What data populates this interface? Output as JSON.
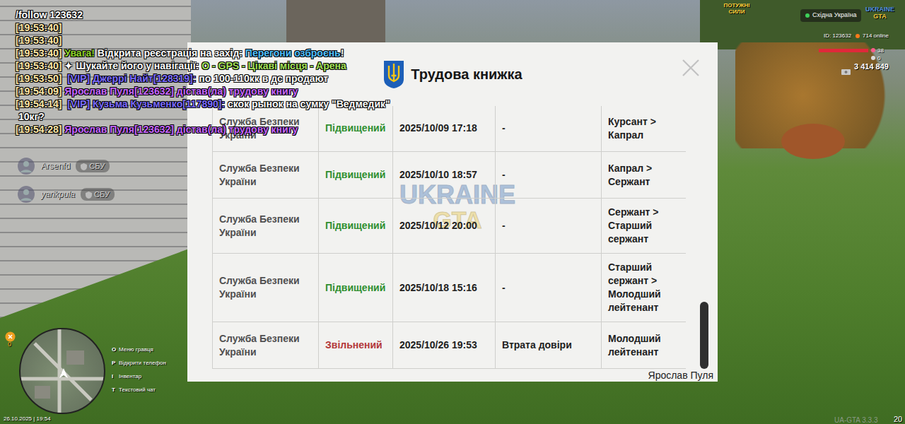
{
  "chat": [
    {
      "segments": [
        {
          "text": "/follow 123632",
          "color": "#ffffff"
        }
      ]
    },
    {
      "segments": [
        {
          "text": "[19:53:40]",
          "color": "#ffe7a6"
        }
      ]
    },
    {
      "segments": [
        {
          "text": "[19:53:40]",
          "color": "#ffe7a6"
        }
      ]
    },
    {
      "segments": [
        {
          "text": "[19:53:40] ",
          "color": "#ffe7a6"
        },
        {
          "text": "Увага! ",
          "color": "#8fd62a"
        },
        {
          "text": "Відкрита реєстрація на захід: ",
          "color": "#ffffff"
        },
        {
          "text": "Перегони озброєнь",
          "color": "#4fc0ff"
        },
        {
          "text": "!",
          "color": "#ffffff"
        }
      ]
    },
    {
      "segments": [
        {
          "text": "[19:53:40] ",
          "color": "#ffe7a6"
        },
        {
          "text": "✦ Шукайте його у навігації: ",
          "color": "#ffffff"
        },
        {
          "text": "O - GPS - Цікаві місця - Арена",
          "color": "#a6e35a"
        }
      ]
    },
    {
      "segments": [
        {
          "text": "[19:53:50] ",
          "color": "#ffe7a6"
        },
        {
          "text": " [VIP] Джеррі Найт[128319]: ",
          "color": "#7c6cff"
        },
        {
          "text": "по 100-110кк в дс продают",
          "color": "#ffffff"
        }
      ]
    },
    {
      "segments": [
        {
          "text": "[19:54:09] ",
          "color": "#ffe7a6"
        },
        {
          "text": "Ярослав Пуля[123632] дістав(ла) трудову книгу",
          "color": "#c766ff"
        }
      ]
    },
    {
      "segments": [
        {
          "text": "[19:54:14] ",
          "color": "#ffe7a6"
        },
        {
          "text": " [VIP] Кузьма Кузьменко[117890]: ",
          "color": "#7c6cff"
        },
        {
          "text": "скок рынок на сумку \"Ведмедик\"",
          "color": "#ffffff"
        }
      ]
    },
    {
      "segments": [
        {
          "text": " 10кг?",
          "color": "#ffffff"
        }
      ]
    },
    {
      "segments": [
        {
          "text": "[19:54:28] ",
          "color": "#ffe7a6"
        },
        {
          "text": "Ярослав Пуля[123632] дістав(ла) трудову книгу",
          "color": "#c766ff"
        }
      ]
    }
  ],
  "nametags": [
    {
      "name": "Arsenfd",
      "badge": "СБУ"
    },
    {
      "name": "yarikpula",
      "badge": "СБУ"
    }
  ],
  "hud": {
    "event_logo": "ПОТУЖНІ СИЛИ",
    "region": "Східна Україна",
    "logo": [
      "UKRAINE",
      "GTA"
    ],
    "id": "ID: 123632",
    "online": "714 online",
    "health": {
      "reading": "38",
      "level": 1.0
    },
    "armor": {
      "reading": "0"
    },
    "money": "3 414 849"
  },
  "modal": {
    "title": "Трудова книжка",
    "watermark": [
      "UKRAINE",
      "GTA"
    ],
    "rows": [
      {
        "org": "Служба Безпеки України",
        "status": "Підвищений",
        "color": "#2f8f2f",
        "date": "2025/10/09 17:18",
        "reason": "-",
        "rank": "Курсант > Капрал"
      },
      {
        "org": "Служба Безпеки України",
        "status": "Підвищений",
        "color": "#2f8f2f",
        "date": "2025/10/10 18:57",
        "reason": "-",
        "rank": "Капрал > Сержант"
      },
      {
        "org": "Служба Безпеки України",
        "status": "Підвищений",
        "color": "#2f8f2f",
        "date": "2025/10/12 20:00",
        "reason": "-",
        "rank": "Сержант > Старший сержант"
      },
      {
        "org": "Служба Безпеки України",
        "status": "Підвищений",
        "color": "#2f8f2f",
        "date": "2025/10/18 15:16",
        "reason": "-",
        "rank": "Старший сержант > Молодший лейтенант"
      },
      {
        "org": "Служба Безпеки України",
        "status": "Звільнений",
        "color": "#b3383a",
        "date": "2025/10/26 19:53",
        "reason": "Втрата довіри",
        "rank": "Молодший лейтенант"
      }
    ],
    "scroll_position": 1.0,
    "owner": "Ярослав Пуля"
  },
  "side_counter": "0",
  "minimap_legend": [
    {
      "key": "O",
      "label": "Меню гравця"
    },
    {
      "key": "P",
      "label": "Відкрити телефон"
    },
    {
      "key": "I",
      "label": "Інвентар"
    },
    {
      "key": "T",
      "label": "Текстовий чат"
    }
  ],
  "datetime": "26.10.2025 | 19:54",
  "version": "UA-GTA 3.3.3",
  "fps": "20"
}
